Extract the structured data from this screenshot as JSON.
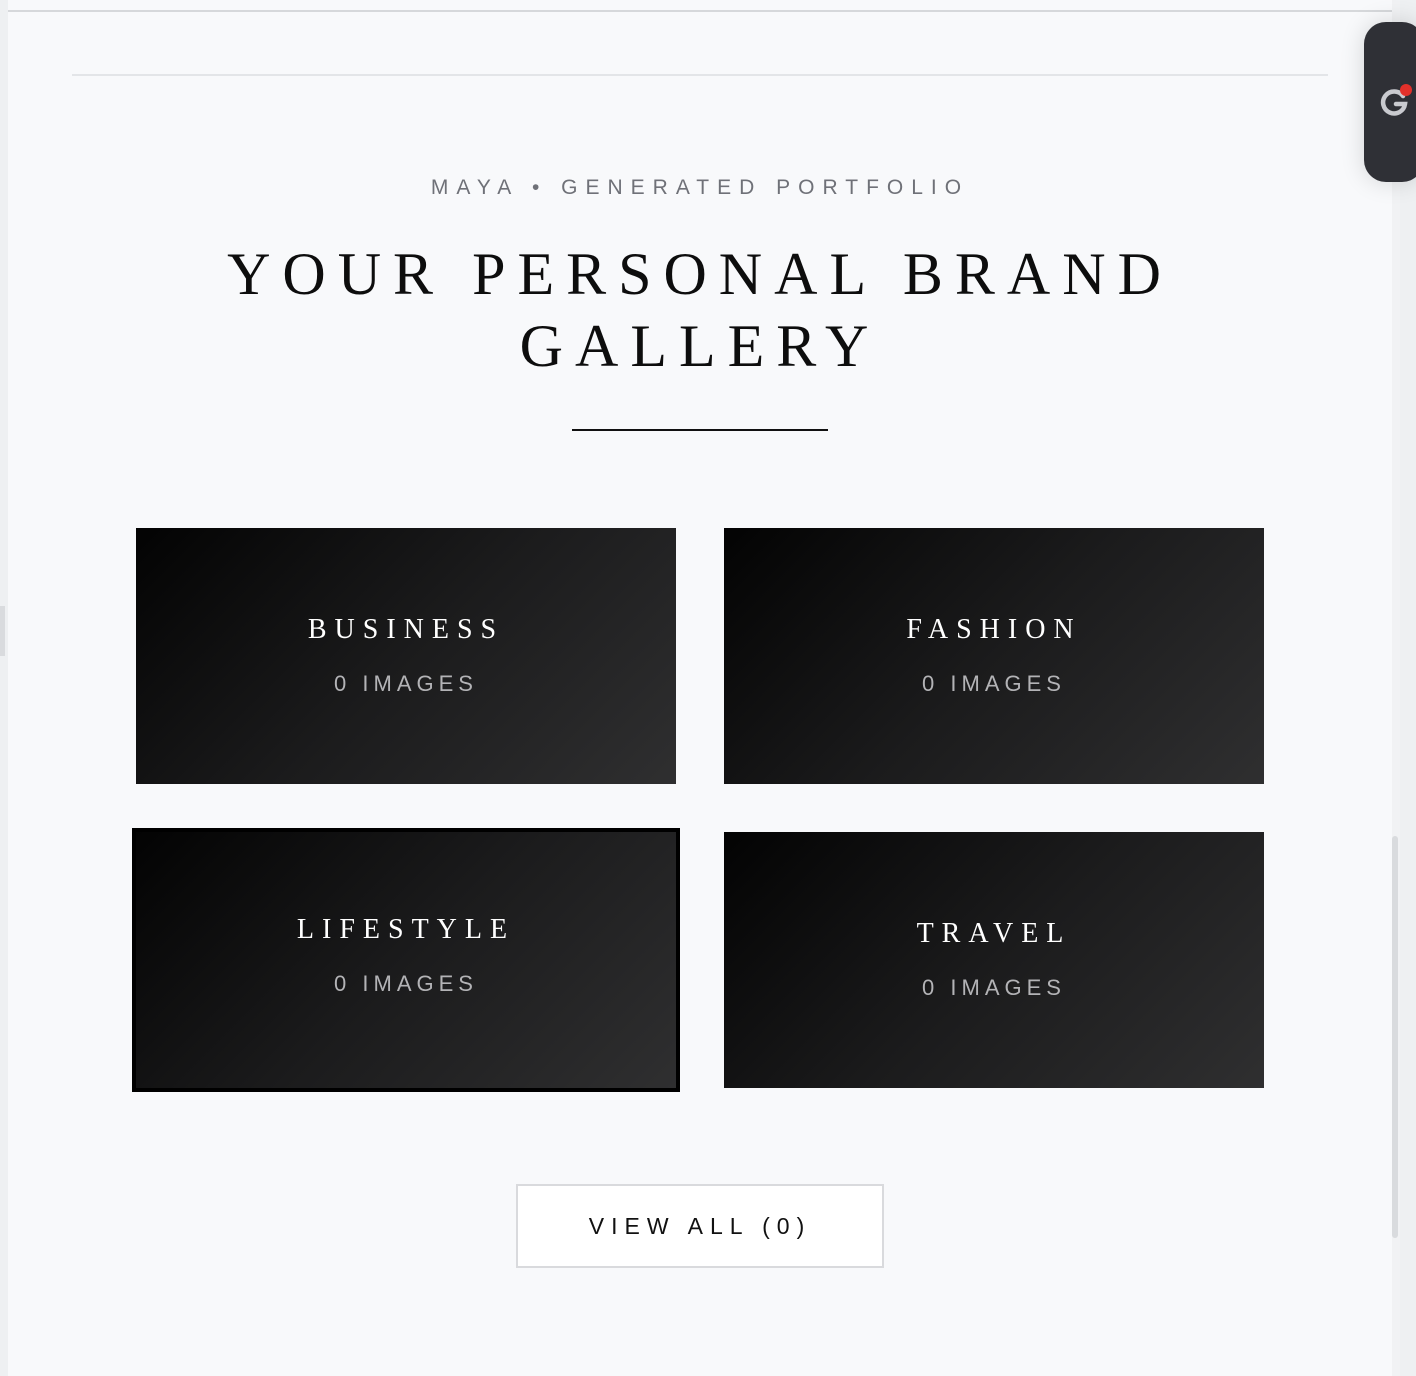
{
  "gallery": {
    "eyebrow": "MAYA • GENERATED PORTFOLIO",
    "headline": "YOUR PERSONAL BRAND GALLERY",
    "categories": [
      {
        "title": "BUSINESS",
        "count": "0 IMAGES"
      },
      {
        "title": "FASHION",
        "count": "0 IMAGES"
      },
      {
        "title": "LIFESTYLE",
        "count": "0 IMAGES"
      },
      {
        "title": "TRAVEL",
        "count": "0 IMAGES"
      }
    ],
    "view_all_label": "VIEW ALL (0)"
  },
  "widget": {
    "icon": "grammarly-g-icon",
    "status_color": "#e2302a"
  },
  "colors": {
    "page_background": "#f8f9fb",
    "card_gradient_start": "#030303",
    "card_gradient_end": "#2f2f30",
    "text_dark": "#0d0d0d"
  }
}
